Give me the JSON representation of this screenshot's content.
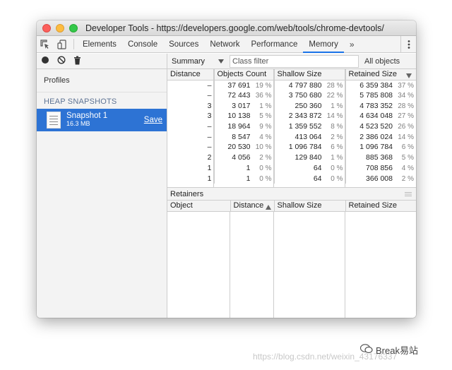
{
  "window": {
    "title": "Developer Tools - https://developers.google.com/web/tools/chrome-devtools/"
  },
  "tabs": [
    {
      "label": "Elements"
    },
    {
      "label": "Console"
    },
    {
      "label": "Sources"
    },
    {
      "label": "Network"
    },
    {
      "label": "Performance"
    },
    {
      "label": "Memory",
      "active": true
    }
  ],
  "tabs_more": "»",
  "sidebar": {
    "profiles_label": "Profiles",
    "section_label": "HEAP SNAPSHOTS",
    "snapshot": {
      "name": "Snapshot 1",
      "size": "16.3 MB",
      "save_label": "Save"
    }
  },
  "toolbar": {
    "view_select": "Summary",
    "filter_placeholder": "Class filter",
    "scope": "All objects"
  },
  "summary_table": {
    "columns": [
      "Distance",
      "Objects Count",
      "Shallow Size",
      "Retained Size"
    ],
    "rows": [
      {
        "distance": "–",
        "count": "37 691",
        "count_pct": "19 %",
        "shallow": "4 797 880",
        "shallow_pct": "28 %",
        "retained": "6 359 384",
        "retained_pct": "37 %"
      },
      {
        "distance": "–",
        "count": "72 443",
        "count_pct": "36 %",
        "shallow": "3 750 680",
        "shallow_pct": "22 %",
        "retained": "5 785 808",
        "retained_pct": "34 %"
      },
      {
        "distance": "3",
        "count": "3 017",
        "count_pct": "1 %",
        "shallow": "250 360",
        "shallow_pct": "1 %",
        "retained": "4 783 352",
        "retained_pct": "28 %"
      },
      {
        "distance": "3",
        "count": "10 138",
        "count_pct": "5 %",
        "shallow": "2 343 872",
        "shallow_pct": "14 %",
        "retained": "4 634 048",
        "retained_pct": "27 %"
      },
      {
        "distance": "–",
        "count": "18 964",
        "count_pct": "9 %",
        "shallow": "1 359 552",
        "shallow_pct": "8 %",
        "retained": "4 523 520",
        "retained_pct": "26 %"
      },
      {
        "distance": "–",
        "count": "8 547",
        "count_pct": "4 %",
        "shallow": "413 064",
        "shallow_pct": "2 %",
        "retained": "2 386 024",
        "retained_pct": "14 %"
      },
      {
        "distance": "–",
        "count": "20 530",
        "count_pct": "10 %",
        "shallow": "1 096 784",
        "shallow_pct": "6 %",
        "retained": "1 096 784",
        "retained_pct": "6 %"
      },
      {
        "distance": "2",
        "count": "4 056",
        "count_pct": "2 %",
        "shallow": "129 840",
        "shallow_pct": "1 %",
        "retained": "885 368",
        "retained_pct": "5 %"
      },
      {
        "distance": "1",
        "count": "1",
        "count_pct": "0 %",
        "shallow": "64",
        "shallow_pct": "0 %",
        "retained": "708 856",
        "retained_pct": "4 %"
      },
      {
        "distance": "1",
        "count": "1",
        "count_pct": "0 %",
        "shallow": "64",
        "shallow_pct": "0 %",
        "retained": "366 008",
        "retained_pct": "2 %"
      }
    ]
  },
  "retainers": {
    "title": "Retainers",
    "columns": [
      "Object",
      "Distance",
      "Shallow Size",
      "Retained Size"
    ]
  },
  "watermark": {
    "url": "https://blog.csdn.net/weixin_43176337",
    "brand": "Break易站"
  },
  "colors": {
    "selection": "#2d73d4",
    "active_tab_underline": "#1a73e8"
  }
}
